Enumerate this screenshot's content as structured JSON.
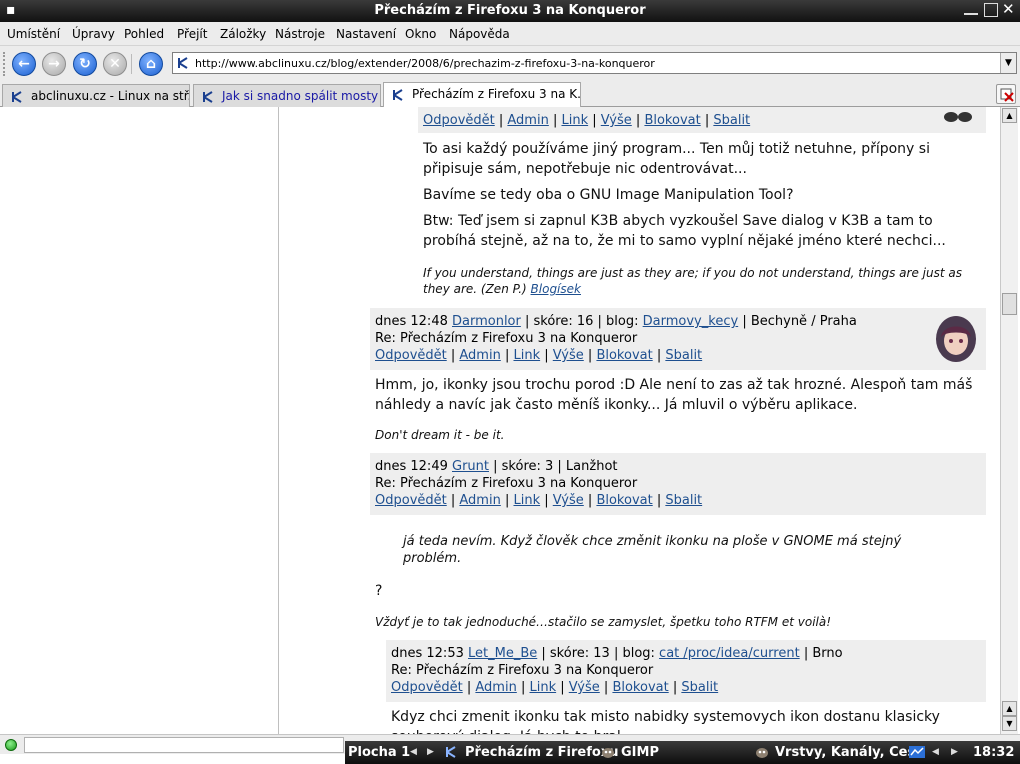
{
  "window": {
    "title": "Přecházím z Firefoxu 3 na Konqueror"
  },
  "menu": [
    "Umístění",
    "Úpravy",
    "Pohled",
    "Přejít",
    "Záložky",
    "Nástroje",
    "Nastavení",
    "Okno",
    "Nápověda"
  ],
  "url": "http://www.abclinuxu.cz/blog/extender/2008/6/prechazim-z-firefoxu-3-na-konqueror",
  "tabs": [
    "abclinuxu.cz - Linux na stř...",
    "Jak si snadno spálit mosty",
    "Přecházím z Firefoxu 3 na K..."
  ],
  "actions": [
    "Odpovědět",
    "Admin",
    "Link",
    "Výše",
    "Blokovat",
    "Sbalit"
  ],
  "c0": {
    "body": [
      "To asi každý používáme jiný program... Ten můj totiž netuhne, přípony si připisuje sám, nepotřebuje nic odentrovávat...",
      "Bavíme se tedy oba o GNU Image Manipulation Tool?",
      "Btw: Teď jsem si zapnul K3B abych vyzkoušel Save dialog v K3B a tam to probíhá stejně, až na to, že mi to samo vyplní nějaké jméno které nechci..."
    ],
    "sig": "If you understand, things are just as they are; if you do not understand, things are just as they are. (Zen P.)",
    "sig_link": "Blogísek"
  },
  "c1": {
    "time": "dnes 12:48",
    "user": "Darmonlor",
    "score": "| skóre: 16 | blog:",
    "blog": "Darmovy_kecy",
    "location": "| Bechyně / Praha",
    "subject": "Re: Přecházím z Firefoxu 3 na Konqueror",
    "body": "Hmm, jo, ikonky jsou trochu porod :D Ale není to zas až tak hrozné. Alespoň tam máš náhledy a navíc jak často měníš ikonky... Já mluvil o výběru aplikace.",
    "sig": "Don't dream it - be it."
  },
  "c2": {
    "time": "dnes 12:49",
    "user": "Grunt",
    "score": "| skóre: 3 | Lanžhot",
    "subject": "Re: Přecházím z Firefoxu 3 na Konqueror",
    "quote": "já teda nevím. Když člověk chce změnit ikonku na ploše v GNOME má stejný problém.",
    "body": "?",
    "sig": "Vždyť je to tak jednoduché…stačilo se zamyslet, špetku toho RTFM et voilà!"
  },
  "c3": {
    "time": "dnes 12:53",
    "user": "Let_Me_Be",
    "score": "| skóre: 13 | blog:",
    "blog": "cat /proc/idea/current",
    "location": "| Brno",
    "subject": "Re: Přecházím z Firefoxu 3 na Konqueror",
    "body": "Kdyz chci zmenit ikonku tak misto nabidky systemovych ikon dostanu klasicky souborový dialog. Já bych to bral..."
  },
  "taskbar": {
    "desktop": "Plocha 1",
    "task1": "Přecházím z Firefoxu",
    "task2": "GIMP",
    "task3": "Vrstvy, Kanály, Cest",
    "clock": "18:32"
  }
}
